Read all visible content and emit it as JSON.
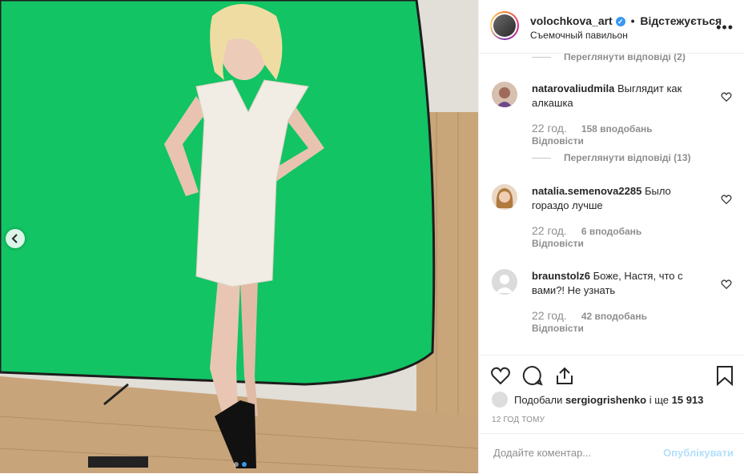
{
  "photo": {
    "icon": "chevron-left-icon",
    "dots": 2,
    "active_dot": 1
  },
  "header": {
    "username": "volochkova_art",
    "separator": "•",
    "follow_label": "Відстежується",
    "location": "Съемочный павильон",
    "more_label": "•••"
  },
  "comments": {
    "top_replies_label": "Переглянути відповіді (2)",
    "items": [
      {
        "username": "natarovaliudmila",
        "text": "Выглядит как алкашка",
        "time": "22 год.",
        "likes": "158 вподобань",
        "reply_label": "Відповісти",
        "view_replies_label": "Переглянути відповіді (13)"
      },
      {
        "username": "natalia.semenova2285",
        "text": "Было гораздо лучше",
        "time": "22 год.",
        "likes": "6 вподобань",
        "reply_label": "Відповісти"
      },
      {
        "username": "braunstolz6",
        "text": "Боже, Настя, что с вами?! Не узнать",
        "time": "22 год.",
        "likes": "42 вподобань",
        "reply_label": "Відповісти"
      }
    ]
  },
  "likes_line": {
    "prefix": "Подобали",
    "user": "sergiogrishenko",
    "middle": "і ще",
    "count": "15 913"
  },
  "timestamp": "12 ГОД ТОМУ",
  "add_comment": {
    "placeholder": "Додайте коментар...",
    "post_label": "Опублікувати"
  },
  "colors": {
    "accent": "#3897f0",
    "post_disabled": "#b2dffc",
    "green_screen": "#10c060"
  }
}
